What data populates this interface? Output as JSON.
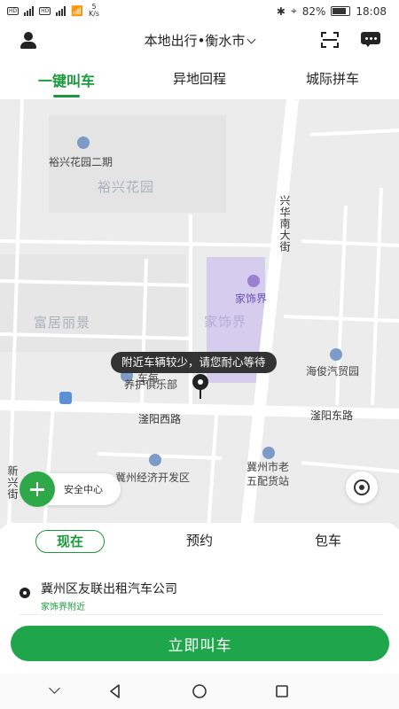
{
  "status_bar": {
    "speed": "5\nK/s",
    "battery": "82%",
    "time": "18:08"
  },
  "header": {
    "title": "本地出行•衡水市"
  },
  "top_tabs": [
    {
      "label": "一键叫车",
      "active": true
    },
    {
      "label": "异地回程",
      "active": false
    },
    {
      "label": "城际拼车",
      "active": false
    }
  ],
  "map": {
    "labels": {
      "yuxing_phase2": "裕兴花园二期",
      "yuxing_garden": "裕兴花园",
      "xinghua_street": "兴华南大街",
      "furniture_poi": "家饰界",
      "furniture_area": "家饰界",
      "fuju": "富居丽景",
      "haijun": "海俊汽贸园",
      "car_club_1": "车每",
      "car_club_2": "养护俱乐部",
      "fuyang_west": "滏阳西路",
      "fuyang_east": "滏阳东路",
      "dev_zone": "冀州经济开发区",
      "old_station_1": "冀州市老",
      "old_station_2": "五配货站",
      "xinxing_street": "新兴街"
    },
    "tooltip": "附近车辆较少，请您耐心等待",
    "safety_center": "安全中心"
  },
  "booking": {
    "modes": [
      {
        "label": "现在",
        "active": true
      },
      {
        "label": "预约",
        "active": false
      },
      {
        "label": "包车",
        "active": false
      }
    ],
    "origin_name": "冀州区友联出租汽车公司",
    "origin_hint": "家饰界附近",
    "call_button": "立即叫车"
  },
  "colors": {
    "accent": "#1a9a3c",
    "button": "#1fa64a",
    "map_bg": "#ececec",
    "highlight_area": "#d6cdee"
  }
}
